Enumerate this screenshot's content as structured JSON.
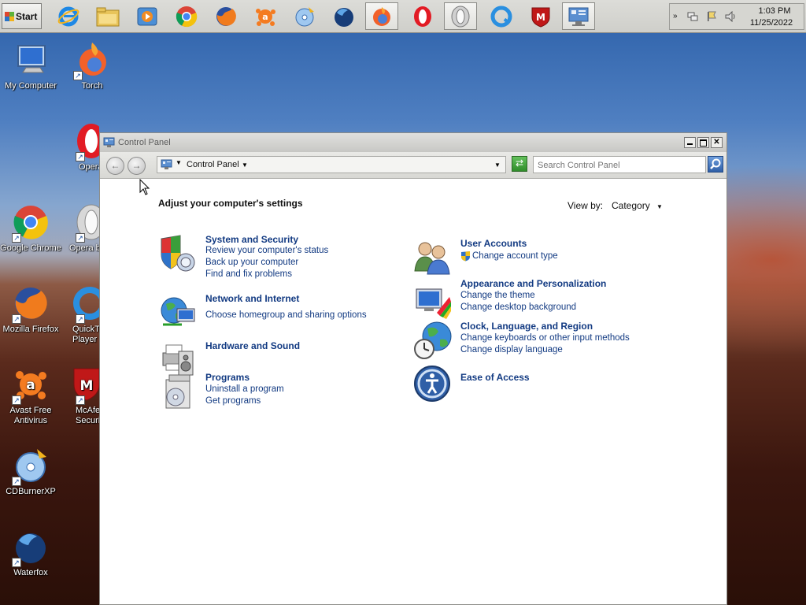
{
  "taskbar": {
    "start_label": "Start",
    "quicklaunch": [
      {
        "icon": "internet-explorer-icon"
      },
      {
        "icon": "folder-icon"
      },
      {
        "icon": "media-player-icon"
      },
      {
        "icon": "google-chrome-icon"
      },
      {
        "icon": "firefox-icon"
      },
      {
        "icon": "avast-icon"
      },
      {
        "icon": "cdburnerxp-icon"
      },
      {
        "icon": "waterfox-icon"
      },
      {
        "icon": "torch-icon"
      },
      {
        "icon": "opera-icon"
      },
      {
        "icon": "opera-beta-icon"
      },
      {
        "icon": "quicktime-icon"
      },
      {
        "icon": "mcafee-icon"
      },
      {
        "icon": "control-panel-icon"
      }
    ],
    "tray": {
      "time": "1:03 PM",
      "date": "11/25/2022"
    }
  },
  "desktop": {
    "icons": [
      {
        "label": "My Computer",
        "icon": "my-computer-icon"
      },
      {
        "label": "Torch",
        "icon": "torch-icon"
      },
      {
        "label": "Opera",
        "icon": "opera-icon"
      },
      {
        "label": "Google Chrome",
        "icon": "google-chrome-icon"
      },
      {
        "label": "Opera beta",
        "icon": "opera-beta-icon"
      },
      {
        "label": "Mozilla Firefox",
        "icon": "firefox-icon"
      },
      {
        "label": "QuickTime Player",
        "icon": "quicktime-icon"
      },
      {
        "label": "Avast Free Antivirus",
        "icon": "avast-icon"
      },
      {
        "label": "McAfee Security",
        "icon": "mcafee-icon"
      },
      {
        "label": "CDBurnerXP",
        "icon": "cdburnerxp-icon"
      },
      {
        "label": "Waterfox",
        "icon": "waterfox-icon"
      }
    ]
  },
  "window": {
    "title": "Control Panel",
    "address": "Control Panel",
    "search_placeholder": "Search Control Panel",
    "heading": "Adjust your computer's settings",
    "view_by_label": "View by:",
    "view_by_value": "Category",
    "left_categories": [
      {
        "title": "System and Security",
        "links": [
          "Review your computer's status",
          "Back up your computer",
          "Find and fix problems"
        ]
      },
      {
        "title": "Network and Internet",
        "links": [
          "Choose homegroup and sharing options"
        ]
      },
      {
        "title": "Hardware and Sound",
        "links": []
      },
      {
        "title": "Programs",
        "links": [
          "Uninstall a program",
          "Get programs"
        ]
      }
    ],
    "right_categories": [
      {
        "title": "User Accounts",
        "links": [
          "Change account type"
        ]
      },
      {
        "title": "Appearance and Personalization",
        "links": [
          "Change the theme",
          "Change desktop background"
        ]
      },
      {
        "title": "Clock, Language, and Region",
        "links": [
          "Change keyboards or other input methods",
          "Change display language"
        ]
      },
      {
        "title": "Ease of Access",
        "links": []
      }
    ]
  },
  "colors": {
    "link": "#123a82",
    "window_bg": "#ffffff",
    "taskbar_bg": "#d4d4d0"
  }
}
